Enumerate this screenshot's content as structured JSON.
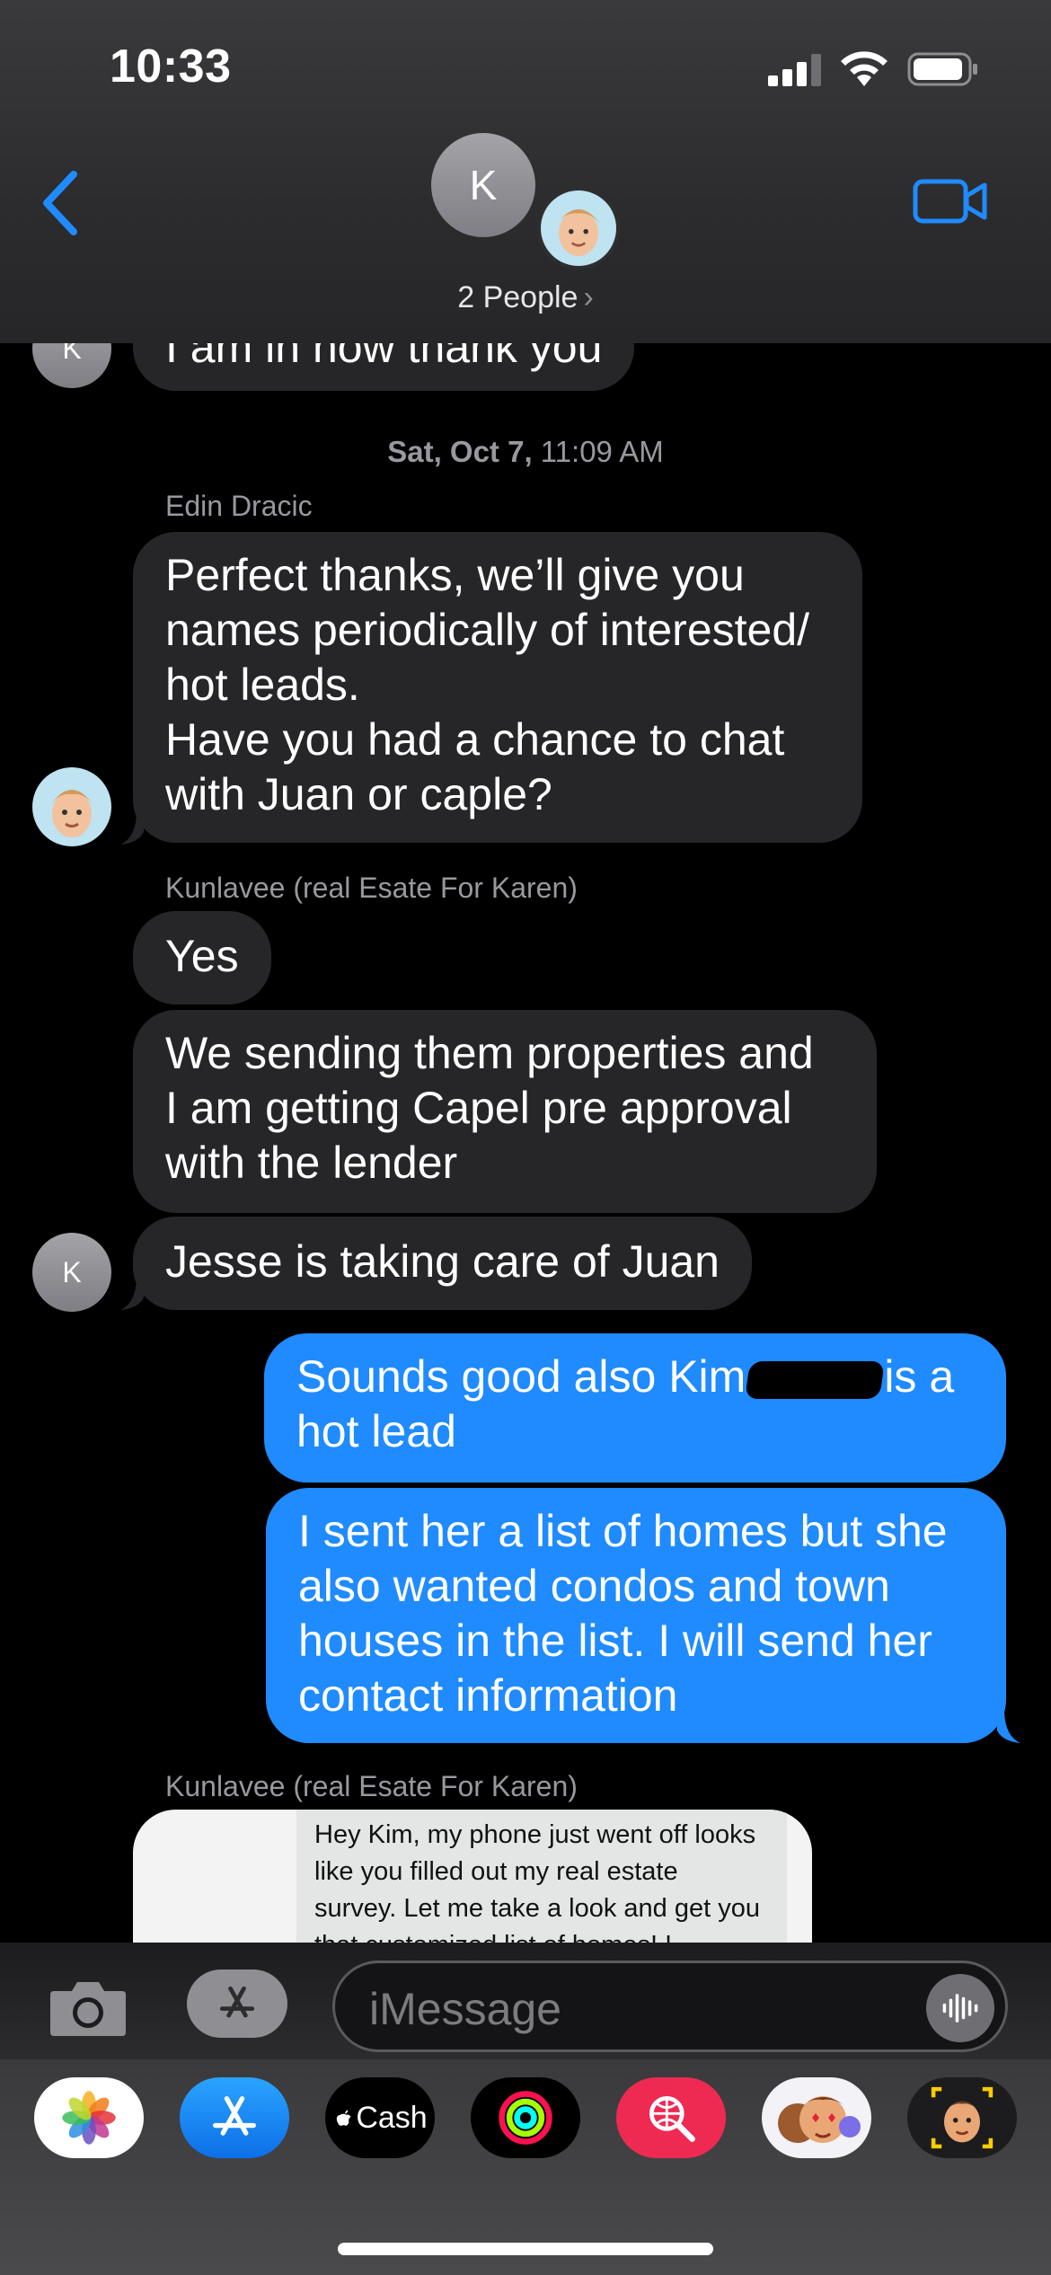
{
  "status_bar": {
    "time": "10:33"
  },
  "header": {
    "avatar_initial": "K",
    "people_label": "2 People",
    "chevron": "›"
  },
  "messages": {
    "partial_top": "I am in now thank you",
    "timestamp_day": "Sat, Oct 7,",
    "timestamp_time": "11:09 AM",
    "sender_edin": "Edin Dracic",
    "edin_msg": [
      "Perfect thanks, we’ll give you",
      "names periodically of interested/",
      "hot leads.",
      "Have you had a chance to chat",
      "with Juan or caple?"
    ],
    "sender_kunlavee": "Kunlavee (real Esate For Karen)",
    "k_msg1": "Yes",
    "k_msg2": [
      "We sending them properties and",
      "I am getting Capel pre approval",
      "with the lender"
    ],
    "k_msg3": "Jesse is taking care of Juan",
    "avatar_k": "K",
    "me_msg1_a": "Sounds good also Kim",
    "me_msg1_b": "is a",
    "me_msg1_c": "hot lead",
    "me_msg2": [
      "I sent her a list of homes but she",
      "also wanted condos and town",
      "houses in the list. I will send her",
      "contact information"
    ],
    "sender_kunlavee_2": "Kunlavee (real Esate For Karen)",
    "attachment_text": [
      "Hey Kim, my phone just went off looks",
      "like you filled out my real estate",
      "survey. Let me take a look and get you",
      "that customized list of homes! !"
    ]
  },
  "input_bar": {
    "placeholder": "iMessage"
  },
  "app_drawer": {
    "apps": [
      {
        "name": "photos",
        "icon": "photos-icon"
      },
      {
        "name": "app-store",
        "icon": "app-store-icon"
      },
      {
        "name": "cash",
        "label": "Cash",
        "icon": "apple-cash-icon"
      },
      {
        "name": "fitness",
        "icon": "activity-rings-icon"
      },
      {
        "name": "search",
        "icon": "globe-search-icon"
      },
      {
        "name": "memoji-stickers",
        "icon": "memoji-stickers-icon"
      },
      {
        "name": "memoji",
        "icon": "memoji-icon"
      }
    ]
  },
  "colors": {
    "accent": "#1f8bff",
    "incoming_bubble": "#262628",
    "background": "#000000"
  }
}
